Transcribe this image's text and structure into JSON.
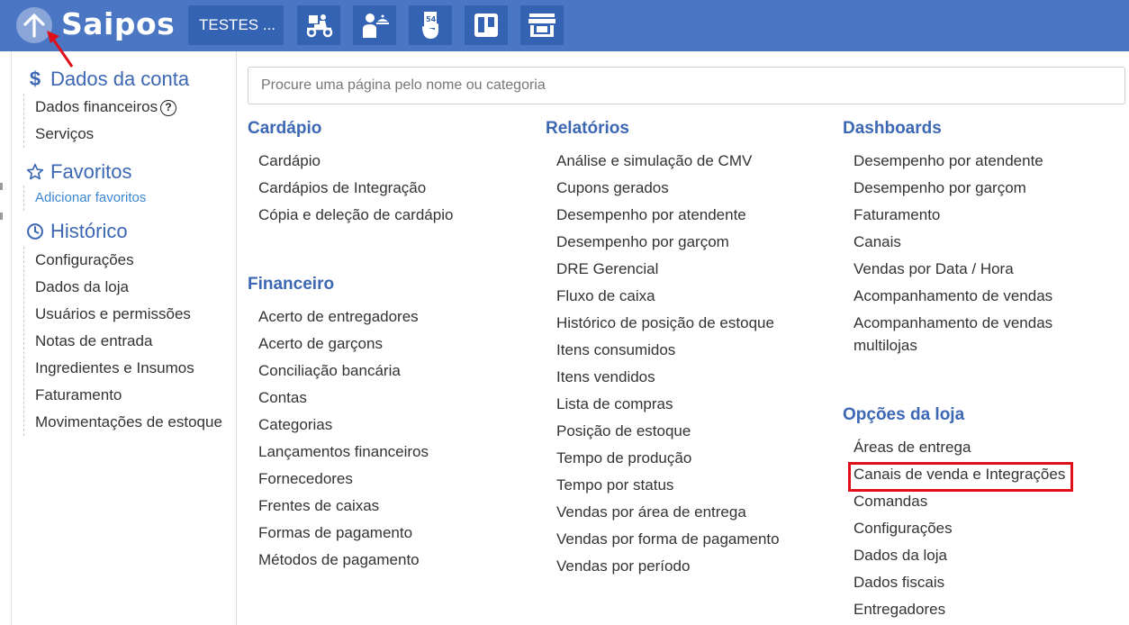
{
  "header": {
    "logo": "Saipos",
    "store_selector": "TESTES ...",
    "icons": [
      "delivery-scooter-icon",
      "waiter-icon",
      "order-ticket-icon",
      "trello-board-icon",
      "storefront-icon"
    ]
  },
  "sidebar": {
    "account": {
      "title": "Dados da conta",
      "items": [
        "Dados financeiros",
        "Serviços"
      ],
      "help": "?"
    },
    "favorites": {
      "title": "Favoritos",
      "add_link": "Adicionar favoritos"
    },
    "history": {
      "title": "Histórico",
      "items": [
        "Configurações",
        "Dados da loja",
        "Usuários e permissões",
        "Notas de entrada",
        "Ingredientes e Insumos",
        "Faturamento",
        "Movimentações de estoque"
      ]
    }
  },
  "search": {
    "placeholder": "Procure uma página pelo nome ou categoria"
  },
  "categories": {
    "cardapio": {
      "title": "Cardápio",
      "items": [
        "Cardápio",
        "Cardápios de Integração",
        "Cópia e deleção de cardápio"
      ]
    },
    "financeiro": {
      "title": "Financeiro",
      "items": [
        "Acerto de entregadores",
        "Acerto de garçons",
        "Conciliação bancária",
        "Contas",
        "Categorias",
        "Lançamentos financeiros",
        "Fornecedores",
        "Frentes de caixas",
        "Formas de pagamento",
        "Métodos de pagamento"
      ]
    },
    "relatorios": {
      "title": "Relatórios",
      "items": [
        "Análise e simulação de CMV",
        "Cupons gerados",
        "Desempenho por atendente",
        "Desempenho por garçom",
        "DRE Gerencial",
        "Fluxo de caixa",
        "Histórico de posição de estoque",
        "Itens consumidos",
        "Itens vendidos",
        "Lista de compras",
        "Posição de estoque",
        "Tempo de produção",
        "Tempo por status",
        "Vendas por área de entrega",
        "Vendas por forma de pagamento",
        "Vendas por período"
      ]
    },
    "dashboards": {
      "title": "Dashboards",
      "items": [
        "Desempenho por atendente",
        "Desempenho por garçom",
        "Faturamento",
        "Canais",
        "Vendas por Data / Hora",
        "Acompanhamento de vendas",
        "Acompanhamento de vendas multilojas"
      ]
    },
    "opcoes_loja": {
      "title": "Opções da loja",
      "items": [
        "Áreas de entrega",
        "Canais de venda e Integrações",
        "Comandas",
        "Configurações",
        "Dados da loja",
        "Dados fiscais",
        "Entregadores"
      ]
    }
  },
  "colors": {
    "header_bg": "#4a76c4",
    "accent": "#3c67b3",
    "link": "#3c86d2",
    "highlight": "#e0101a",
    "annotation_arrow": "#e0101a"
  }
}
